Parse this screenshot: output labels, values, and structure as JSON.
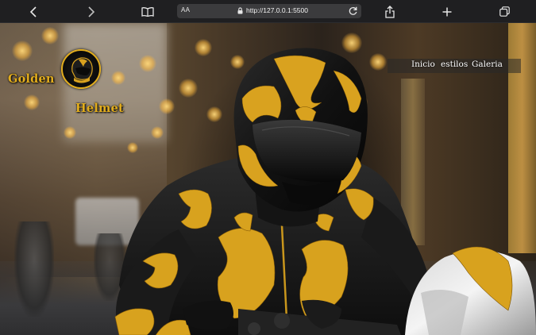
{
  "browser": {
    "url": "http://127.0.0.1:5500",
    "text_size_label": "AA",
    "icons": [
      "back-icon",
      "forward-icon",
      "bookmarks-icon",
      "lock-icon",
      "reload-icon",
      "share-icon",
      "new-tab-icon",
      "tabs-icon"
    ]
  },
  "site": {
    "brand_line_1": "Golden",
    "brand_line_2": "Helmet",
    "accent_color": "#e2ad1d",
    "nav": [
      {
        "label": "Inicio"
      },
      {
        "label": "estilos"
      },
      {
        "label": "Galeria"
      }
    ]
  }
}
